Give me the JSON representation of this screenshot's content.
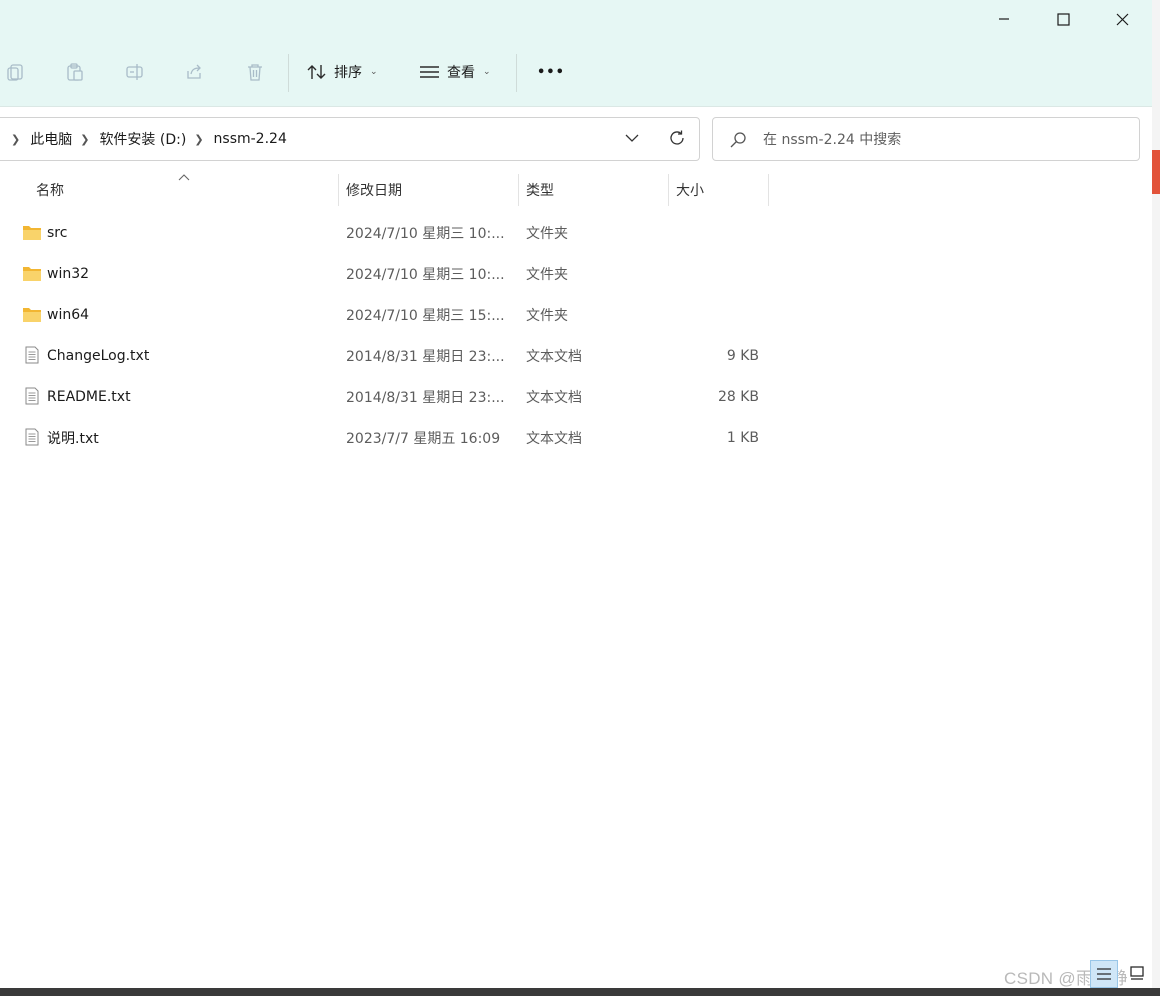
{
  "toolbar": {
    "sort_label": "排序",
    "view_label": "查看",
    "more_label": "•••"
  },
  "address": {
    "crumbs": [
      "此电脑",
      "软件安装 (D:)",
      "nssm-2.24"
    ]
  },
  "search": {
    "placeholder": "在 nssm-2.24 中搜索"
  },
  "columns": {
    "name": "名称",
    "modified": "修改日期",
    "type": "类型",
    "size": "大小"
  },
  "files": [
    {
      "name": "src",
      "modified": "2024/7/10 星期三 10:...",
      "type": "文件夹",
      "size": "",
      "kind": "folder"
    },
    {
      "name": "win32",
      "modified": "2024/7/10 星期三 10:...",
      "type": "文件夹",
      "size": "",
      "kind": "folder"
    },
    {
      "name": "win64",
      "modified": "2024/7/10 星期三 15:...",
      "type": "文件夹",
      "size": "",
      "kind": "folder"
    },
    {
      "name": "ChangeLog.txt",
      "modified": "2014/8/31 星期日 23:...",
      "type": "文本文档",
      "size": "9 KB",
      "kind": "text"
    },
    {
      "name": "README.txt",
      "modified": "2014/8/31 星期日 23:...",
      "type": "文本文档",
      "size": "28 KB",
      "kind": "text"
    },
    {
      "name": "说明.txt",
      "modified": "2023/7/7 星期五 16:09",
      "type": "文本文档",
      "size": "1 KB",
      "kind": "text"
    }
  ],
  "watermark": "CSDN @雨叶静",
  "colors": {
    "toolbar_bg": "#e6f7f4",
    "folder": "#f7c948",
    "accent": "#0067c0"
  }
}
